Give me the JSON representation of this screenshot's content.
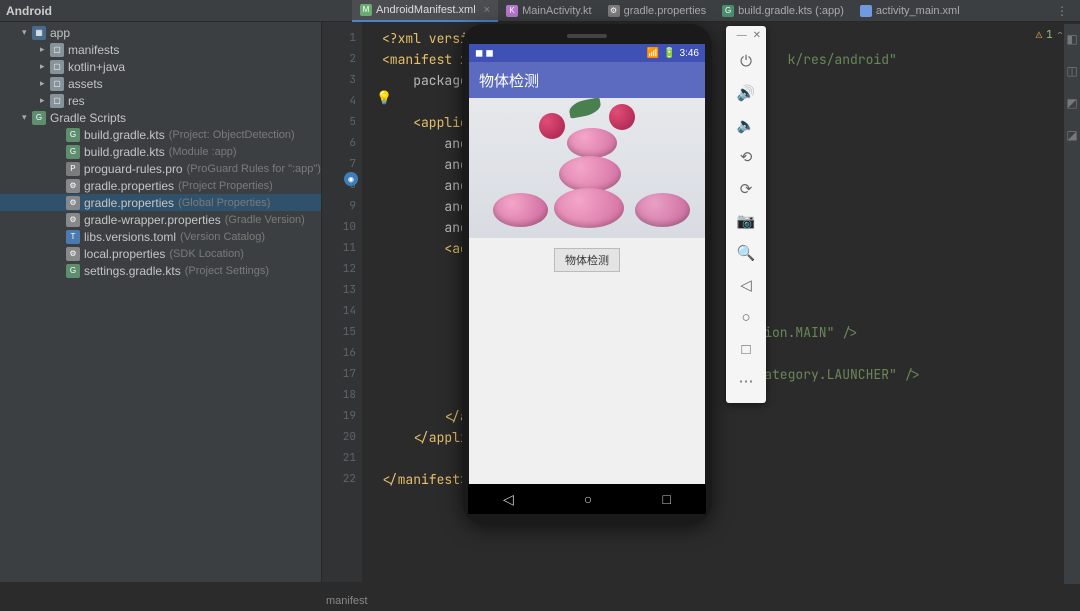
{
  "project_name": "Android",
  "tabs": [
    {
      "label": "AndroidManifest.xml",
      "icon": "M",
      "cls": "ico-manifest",
      "active": true
    },
    {
      "label": "MainActivity.kt",
      "icon": "K",
      "cls": "ico-kt",
      "active": false
    },
    {
      "label": "gradle.properties",
      "icon": "⚙",
      "cls": "ico-props",
      "active": false
    },
    {
      "label": "build.gradle.kts (:app)",
      "icon": "G",
      "cls": "ico-gradle",
      "active": false
    },
    {
      "label": "activity_main.xml",
      "icon": "</>",
      "cls": "ico-xml2",
      "active": false
    }
  ],
  "tree": {
    "app": "app",
    "manifests": "manifests",
    "kotlinjava": "kotlin+java",
    "assets": "assets",
    "res": "res",
    "gradle_scripts": "Gradle Scripts",
    "files": [
      {
        "icon": "G",
        "iclass": "ico-gradlefile",
        "name": "build.gradle.kts",
        "hint": "(Project: ObjectDetection)"
      },
      {
        "icon": "G",
        "iclass": "ico-gradlefile",
        "name": "build.gradle.kts",
        "hint": "(Module :app)"
      },
      {
        "icon": "P",
        "iclass": "ico-proguard",
        "name": "proguard-rules.pro",
        "hint": "(ProGuard Rules for \":app\")"
      },
      {
        "icon": "⚙",
        "iclass": "ico-propfile",
        "name": "gradle.properties",
        "hint": "(Project Properties)"
      },
      {
        "icon": "⚙",
        "iclass": "ico-propfile",
        "name": "gradle.properties",
        "hint": "(Global Properties)",
        "selected": true
      },
      {
        "icon": "⚙",
        "iclass": "ico-propfile",
        "name": "gradle-wrapper.properties",
        "hint": "(Gradle Version)"
      },
      {
        "icon": "T",
        "iclass": "ico-toml",
        "name": "libs.versions.toml",
        "hint": "(Version Catalog)"
      },
      {
        "icon": "⚙",
        "iclass": "ico-propfile",
        "name": "local.properties",
        "hint": "(SDK Location)"
      },
      {
        "icon": "G",
        "iclass": "ico-gradlefile",
        "name": "settings.gradle.kts",
        "hint": "(Project Settings)"
      }
    ]
  },
  "code_lines": {
    "l1": "<?xml versio",
    "l2": "<manifest xm",
    "l2b": "k/res/android\"",
    "l3": "package=",
    "l5": "<applica",
    "l6": "andr",
    "l7": "andr",
    "l8": "andr",
    "l9": "andr",
    "l10": "andr",
    "l11": "<act",
    "l15": "ction.MAIN\" />",
    "l17": ".category.LAUNCHER\" />",
    "l19": "</ac",
    "l20": "</applic",
    "l22": "</manifest>"
  },
  "warnings_badge": "1",
  "emulator": {
    "status_time": "3:46",
    "app_title": "物体检测",
    "button_label": "物体检测"
  },
  "em_toolbar": {
    "buttons": [
      {
        "name": "power",
        "glyph": "⏻"
      },
      {
        "name": "volume-up",
        "glyph": "🔊"
      },
      {
        "name": "volume-down",
        "glyph": "🔈"
      },
      {
        "name": "rotate-left",
        "glyph": "⟲"
      },
      {
        "name": "rotate-right",
        "glyph": "⟳"
      },
      {
        "name": "camera",
        "glyph": "📷"
      },
      {
        "name": "zoom",
        "glyph": "🔍"
      },
      {
        "name": "back",
        "glyph": "◁"
      },
      {
        "name": "home",
        "glyph": "○"
      },
      {
        "name": "overview",
        "glyph": "□"
      },
      {
        "name": "more",
        "glyph": "⋯"
      }
    ]
  },
  "breadcrumb": "manifest"
}
